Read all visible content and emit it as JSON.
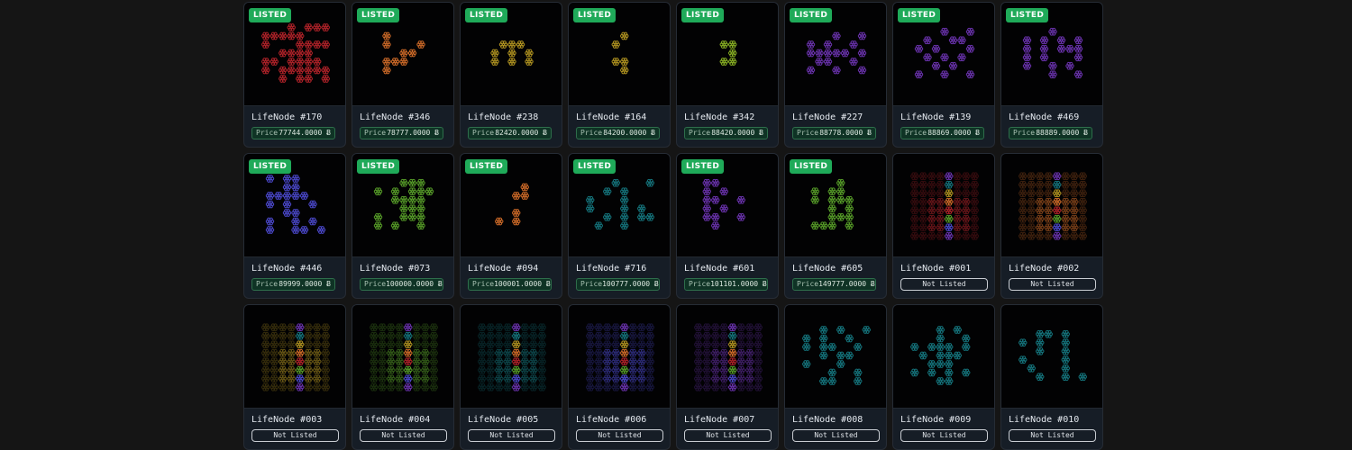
{
  "colors": {
    "red": "#b8242b",
    "orange": "#d9702a",
    "gold": "#b99a22",
    "lime": "#8fb825",
    "purple": "#6f35b5",
    "blue": "#4f4cd6",
    "green": "#5aa32a",
    "teal": "#167a82",
    "listed_badge": "#1faa59"
  },
  "badge_label": "LISTED",
  "price_label": "Price",
  "not_listed_label": "Not Listed",
  "cards": [
    {
      "name": "LifeNode #170",
      "listed": true,
      "price": "77744.0000 Ƀ",
      "color": "red",
      "pattern": [
        "...X.XXX",
        "XXXXX...",
        "X...XXXX",
        "..XXXX..",
        "XX.XXXX.",
        "X.XXXXXX",
        "..X.XX.X"
      ]
    },
    {
      "name": "LifeNode #346",
      "listed": true,
      "price": "78777.0000 Ƀ",
      "color": "orange",
      "pattern": [
        "X....",
        "X...X",
        "..XX.",
        "XXX..",
        "X...."
      ]
    },
    {
      "name": "LifeNode #238",
      "listed": true,
      "price": "82420.0000 Ƀ",
      "color": "gold",
      "pattern": [
        ".XXX.",
        "X.X.X",
        "X.X.X"
      ]
    },
    {
      "name": "LifeNode #164",
      "listed": true,
      "price": "84200.0000 Ƀ",
      "color": "gold",
      "pattern": [
        ".X",
        "X.",
        "..",
        "XX",
        ".X"
      ]
    },
    {
      "name": "LifeNode #342",
      "listed": true,
      "price": "88420.0000 Ƀ",
      "color": "lime",
      "pattern": [
        "XX",
        ".X",
        "XX"
      ]
    },
    {
      "name": "LifeNode #227",
      "listed": true,
      "price": "88778.0000 Ƀ",
      "color": "purple",
      "pattern": [
        "...X..X",
        "X.X..X.",
        "XXXXX.X",
        ".XX..X.",
        "X..X..X"
      ]
    },
    {
      "name": "LifeNode #139",
      "listed": true,
      "price": "88869.0000 Ƀ",
      "color": "purple",
      "pattern": [
        "...X..X",
        ".X..XX.",
        "X.X...X",
        ".X.X.X.",
        "..X.X..",
        "X..X..X"
      ]
    },
    {
      "name": "LifeNode #469",
      "listed": true,
      "price": "88889.0000 Ƀ",
      "color": "purple",
      "pattern": [
        "...X...",
        "X.X.X.X",
        "X.X.XXX",
        "X.X...X",
        "X..X.X.",
        "...X..X"
      ]
    },
    {
      "name": "LifeNode #446",
      "listed": true,
      "price": "89999.0000 Ƀ",
      "color": "blue",
      "pattern": [
        "X.XX...",
        "..XX...",
        "XXXXX..",
        "X.X..X.",
        "..XX...",
        "X..X.X.",
        "X..XX.X"
      ]
    },
    {
      "name": "LifeNode #073",
      "listed": true,
      "price": "100000.0000 Ƀ",
      "color": "green",
      "pattern": [
        "...XXX.",
        "X.X.XXX",
        "..XXXX.",
        "...XXX.",
        "X..XXX.",
        "X.X..X."
      ]
    },
    {
      "name": "LifeNode #094",
      "listed": true,
      "price": "100001.0000 Ƀ",
      "color": "orange",
      "pattern": [
        "...X",
        "..XX",
        "....",
        "..X.",
        "X.X."
      ]
    },
    {
      "name": "LifeNode #716",
      "listed": true,
      "price": "100777.0000 Ƀ",
      "color": "teal",
      "pattern": [
        "...X...X",
        "..X.X...",
        "X...X...",
        "X...X.X.",
        "..X.X.XX",
        ".X..X..."
      ]
    },
    {
      "name": "LifeNode #601",
      "listed": true,
      "price": "101101.0000 Ƀ",
      "color": "purple",
      "pattern": [
        "XX....",
        "X.X...",
        "XX..X.",
        "X.X...",
        "XX..X.",
        ".X...."
      ]
    },
    {
      "name": "LifeNode #605",
      "listed": true,
      "price": "149777.0000 Ƀ",
      "color": "green",
      "pattern": [
        "...X..",
        "X.XX..",
        "X.XXX.",
        "..X.X.",
        "..XXX.",
        "XXX.X."
      ]
    },
    {
      "name": "LifeNode #001",
      "listed": false,
      "style": "full",
      "tint": "red"
    },
    {
      "name": "LifeNode #002",
      "listed": false,
      "style": "full",
      "tint": "orange"
    },
    {
      "name": "LifeNode #003",
      "listed": false,
      "style": "full",
      "tint": "gold"
    },
    {
      "name": "LifeNode #004",
      "listed": false,
      "style": "full",
      "tint": "green"
    },
    {
      "name": "LifeNode #005",
      "listed": false,
      "style": "full",
      "tint": "teal"
    },
    {
      "name": "LifeNode #006",
      "listed": false,
      "style": "full",
      "tint": "blue"
    },
    {
      "name": "LifeNode #007",
      "listed": false,
      "style": "full",
      "tint": "purple"
    },
    {
      "name": "LifeNode #008",
      "listed": false,
      "color": "teal",
      "pattern": [
        "..X.X..X",
        "X.X..X..",
        "X.XX..X.",
        "..X.XX..",
        "X...X...",
        "...X..X.",
        "..XX..X."
      ]
    },
    {
      "name": "LifeNode #009",
      "listed": false,
      "color": "teal",
      "pattern": [
        "...X.X..",
        "...X..X.",
        "X.XXX.X.",
        ".X.XXX..",
        "..XXX...",
        "X.X.X.X.",
        "...XX..."
      ]
    },
    {
      "name": "LifeNode #010",
      "listed": false,
      "color": "teal",
      "pattern": [
        "..XX.X..",
        "X.X..X..",
        "..X..X..",
        "X....X..",
        ".X...X..",
        "..X..X.X"
      ]
    }
  ]
}
